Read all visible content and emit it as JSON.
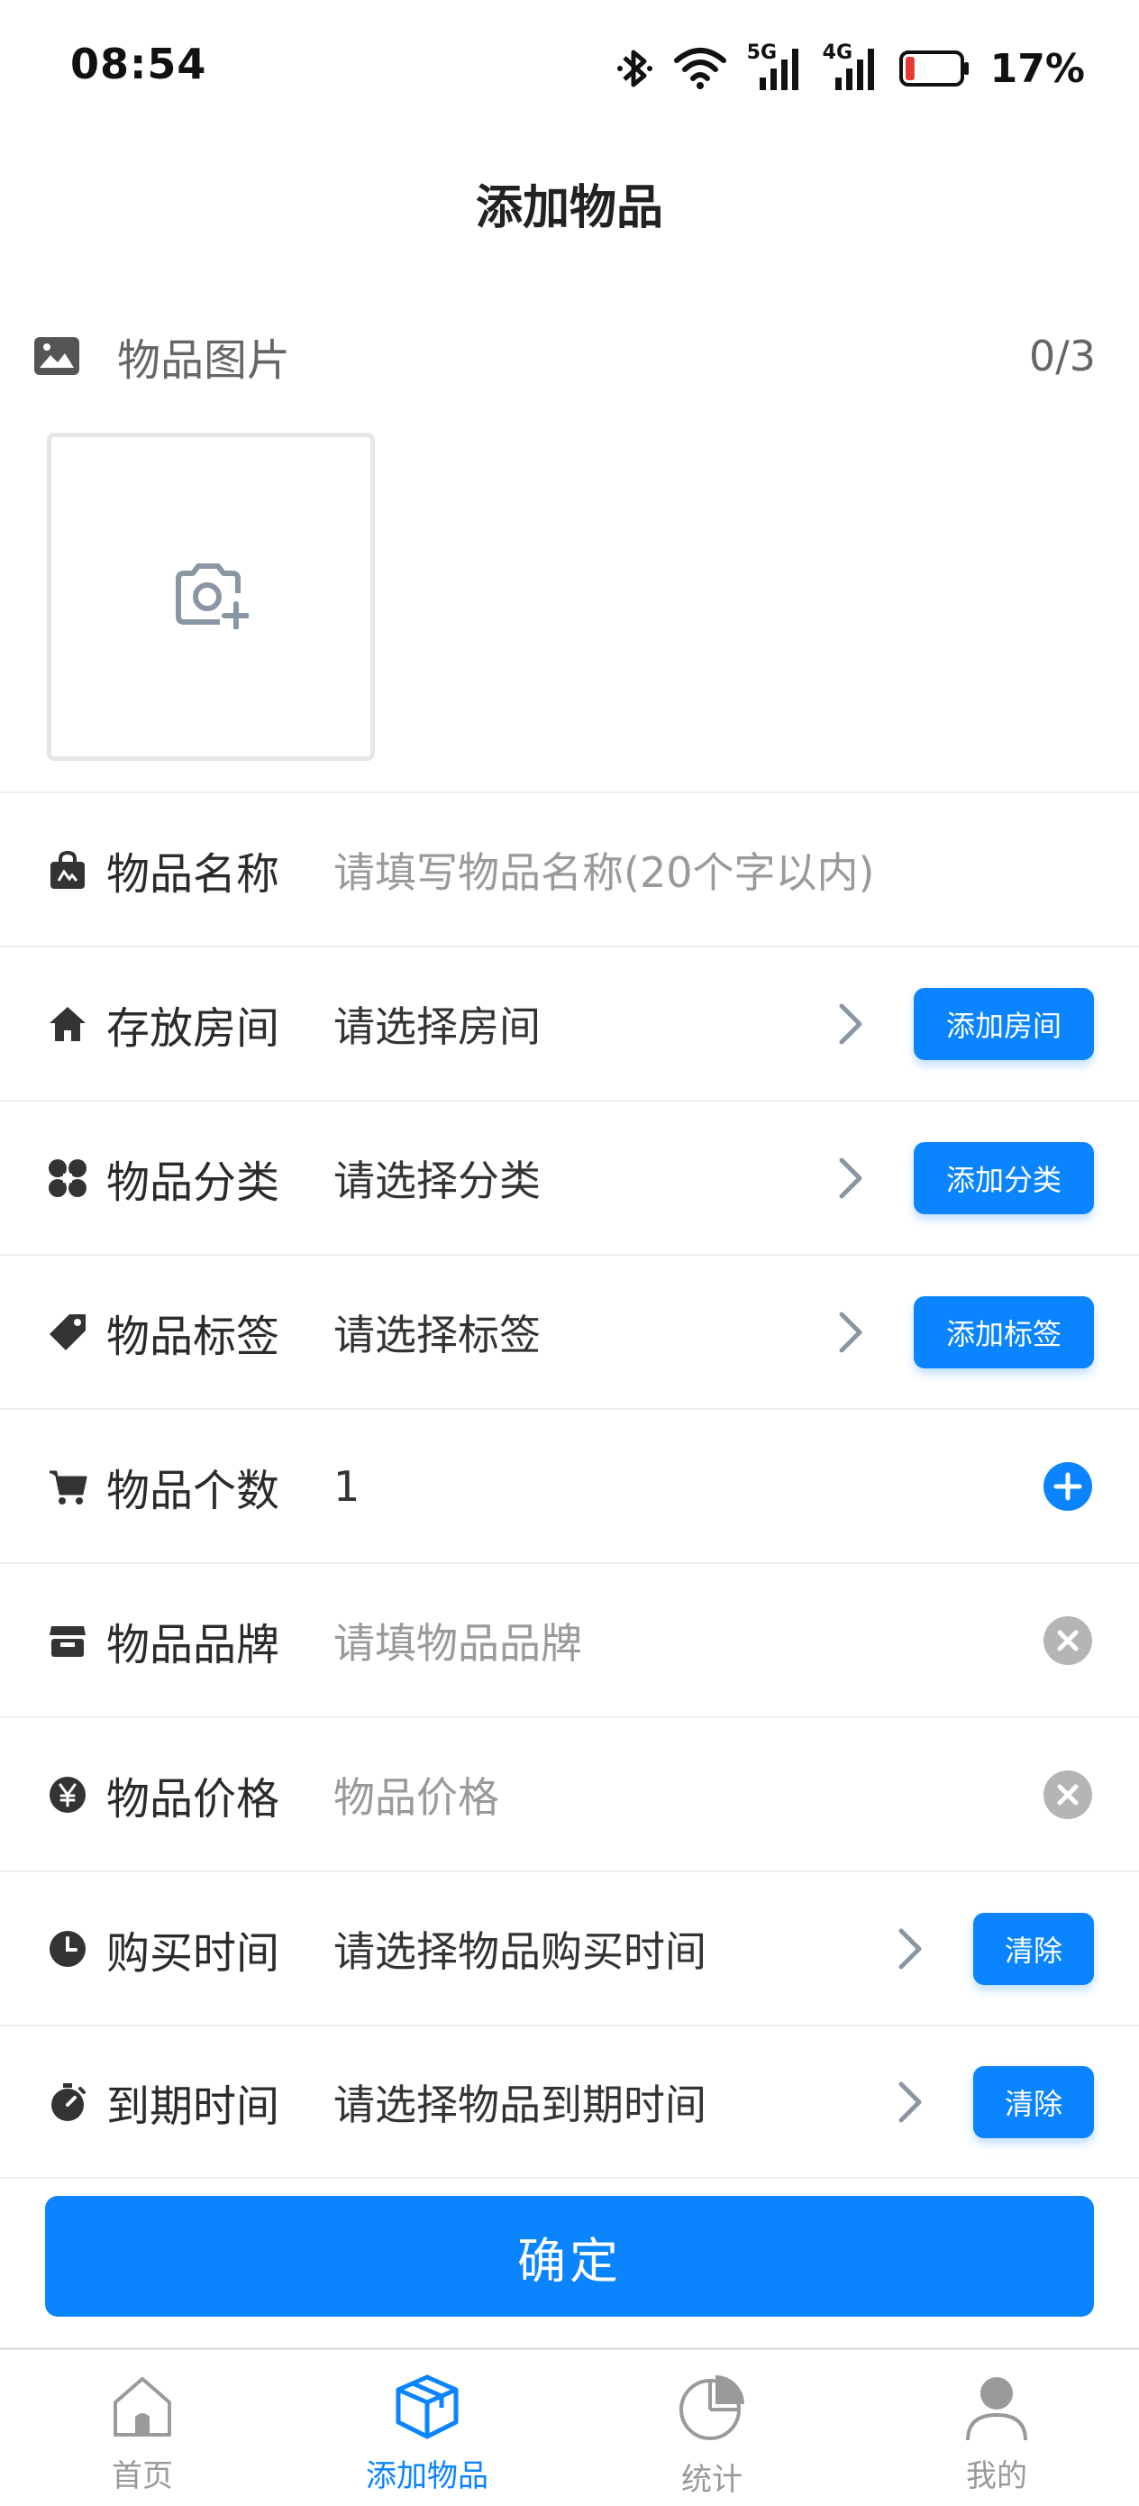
{
  "status_bar": {
    "time": "08:54",
    "network_5g": "5G",
    "network_4g": "4G",
    "battery_percent": "17%",
    "battery_level": 0.17,
    "icons": [
      "bluetooth-icon",
      "wifi-icon",
      "signal-5g-icon",
      "signal-4g-icon",
      "battery-icon"
    ]
  },
  "header": {
    "title": "添加物品"
  },
  "images": {
    "label": "物品图片",
    "count": "0/3",
    "icon": "image-icon",
    "upload_icon": "camera-add-icon"
  },
  "form": {
    "name": {
      "label": "物品名称",
      "placeholder": "请填写物品名称(20个字以内)",
      "icon": "bag-icon"
    },
    "room": {
      "label": "存放房间",
      "value": "请选择房间",
      "button": "添加房间",
      "icon": "home-icon"
    },
    "category": {
      "label": "物品分类",
      "value": "请选择分类",
      "button": "添加分类",
      "icon": "category-icon"
    },
    "tag": {
      "label": "物品标签",
      "value": "请选择标签",
      "button": "添加标签",
      "icon": "tag-icon"
    },
    "quantity": {
      "label": "物品个数",
      "value": "1",
      "icon": "cart-icon"
    },
    "brand": {
      "label": "物品品牌",
      "placeholder": "请填物品品牌",
      "icon": "store-icon"
    },
    "price": {
      "label": "物品价格",
      "placeholder": "物品价格",
      "icon": "yen-icon"
    },
    "purchase_time": {
      "label": "购买时间",
      "value": "请选择物品购买时间",
      "button": "清除",
      "icon": "clock-icon"
    },
    "expire_time": {
      "label": "到期时间",
      "value": "请选择物品到期时间",
      "button": "清除",
      "icon": "timer-icon"
    }
  },
  "confirm_label": "确定",
  "tabs": [
    {
      "label": "首页",
      "icon": "home-tab-icon",
      "active": false
    },
    {
      "label": "添加物品",
      "icon": "box-icon",
      "active": true
    },
    {
      "label": "统计",
      "icon": "pie-chart-icon",
      "active": false
    },
    {
      "label": "我的",
      "icon": "user-icon",
      "active": false
    }
  ],
  "colors": {
    "accent": "#0a84ff",
    "battery_low": "#e53935",
    "clear_icon": "#b5b5b5"
  }
}
